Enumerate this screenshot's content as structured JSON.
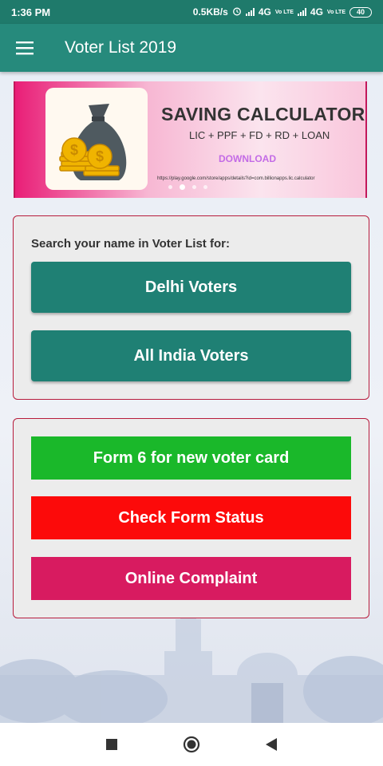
{
  "status_bar": {
    "time": "1:36 PM",
    "speed": "0.5KB/s",
    "network_1": "4G",
    "network_2": "4G",
    "lte_label": "Vo LTE",
    "battery": "40"
  },
  "app_bar": {
    "title": "Voter List 2019",
    "menu_icon": "hamburger-menu-icon"
  },
  "banner": {
    "title": "SAVING CALCULATOR",
    "subtitle": "LIC + PPF + FD + RD + LOAN",
    "cta": "DOWNLOAD",
    "url": "https://play.google.com/store/apps/details?id=com.billionapps.lic.calculator",
    "slide_count": 4,
    "active_slide": 2
  },
  "search_card": {
    "label": "Search your name in Voter List for:",
    "buttons": [
      {
        "label": "Delhi Voters"
      },
      {
        "label": "All India Voters"
      }
    ]
  },
  "forms_card": {
    "buttons": [
      {
        "label": "Form 6 for new voter card",
        "color": "#1ab82a"
      },
      {
        "label": "Check Form Status",
        "color": "#fc0a0a"
      },
      {
        "label": "Online Complaint",
        "color": "#d81b60"
      }
    ]
  },
  "colors": {
    "primary": "#268a7c",
    "status_bar": "#1f7a6b",
    "teal_button": "#1f8074",
    "card_border": "#b71c3c"
  },
  "nav_bar": {
    "icons": [
      "recents-square-icon",
      "home-circle-icon",
      "back-triangle-icon"
    ]
  }
}
